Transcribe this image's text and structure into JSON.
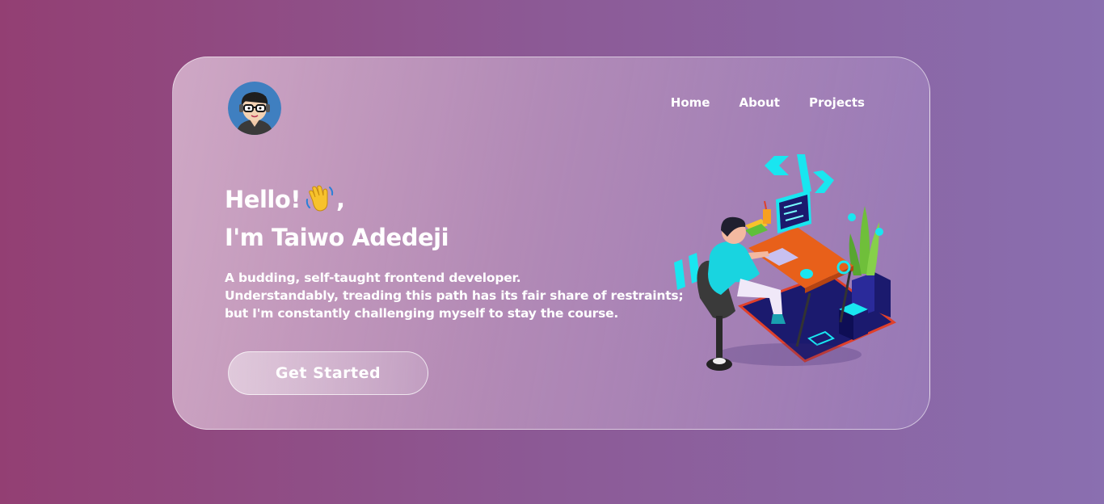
{
  "nav": {
    "items": [
      "Home",
      "About",
      "Projects"
    ]
  },
  "hero": {
    "greeting": "Hello!",
    "greeting_suffix": ",",
    "name_line": "I'm Taiwo Adedeji",
    "bio_lines": [
      "A budding, self-taught frontend developer.",
      "Understandably, treading this path has its fair share of restraints;",
      "but I'm constantly challenging myself to stay the course."
    ],
    "cta_label": "Get Started"
  },
  "icons": {
    "avatar": "avatar-icon",
    "wave": "waving-hand-icon",
    "illustration": "developer-desk-illustration"
  },
  "colors": {
    "accent_cyan": "#19e6f0",
    "desk_orange": "#e8601a",
    "floor_navy": "#1b1a6e"
  }
}
